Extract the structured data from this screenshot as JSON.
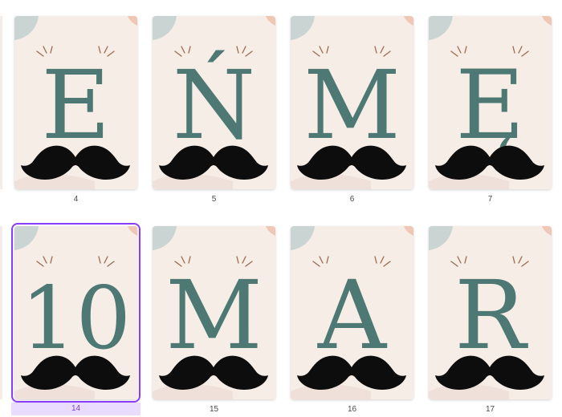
{
  "colors": {
    "card_bg": "#f7ede7",
    "letter": "#4d7873",
    "mustache": "#0d0d0d",
    "corner_blue": "#c9d4d3",
    "corner_peach": "#f0c7b5",
    "sparkle": "#9a6a4d",
    "selection": "#8b3dff",
    "selected_label_bg": "#e9dcff"
  },
  "pages": [
    {
      "letter": "E",
      "number": "4",
      "selected": false
    },
    {
      "letter": "Ń",
      "number": "5",
      "selected": false
    },
    {
      "letter": "M",
      "number": "6",
      "selected": false
    },
    {
      "letter": "Ę",
      "number": "7",
      "selected": false
    },
    {
      "letter": "10",
      "number": "14",
      "selected": true
    },
    {
      "letter": "M",
      "number": "15",
      "selected": false
    },
    {
      "letter": "A",
      "number": "16",
      "selected": false
    },
    {
      "letter": "R",
      "number": "17",
      "selected": false
    }
  ]
}
